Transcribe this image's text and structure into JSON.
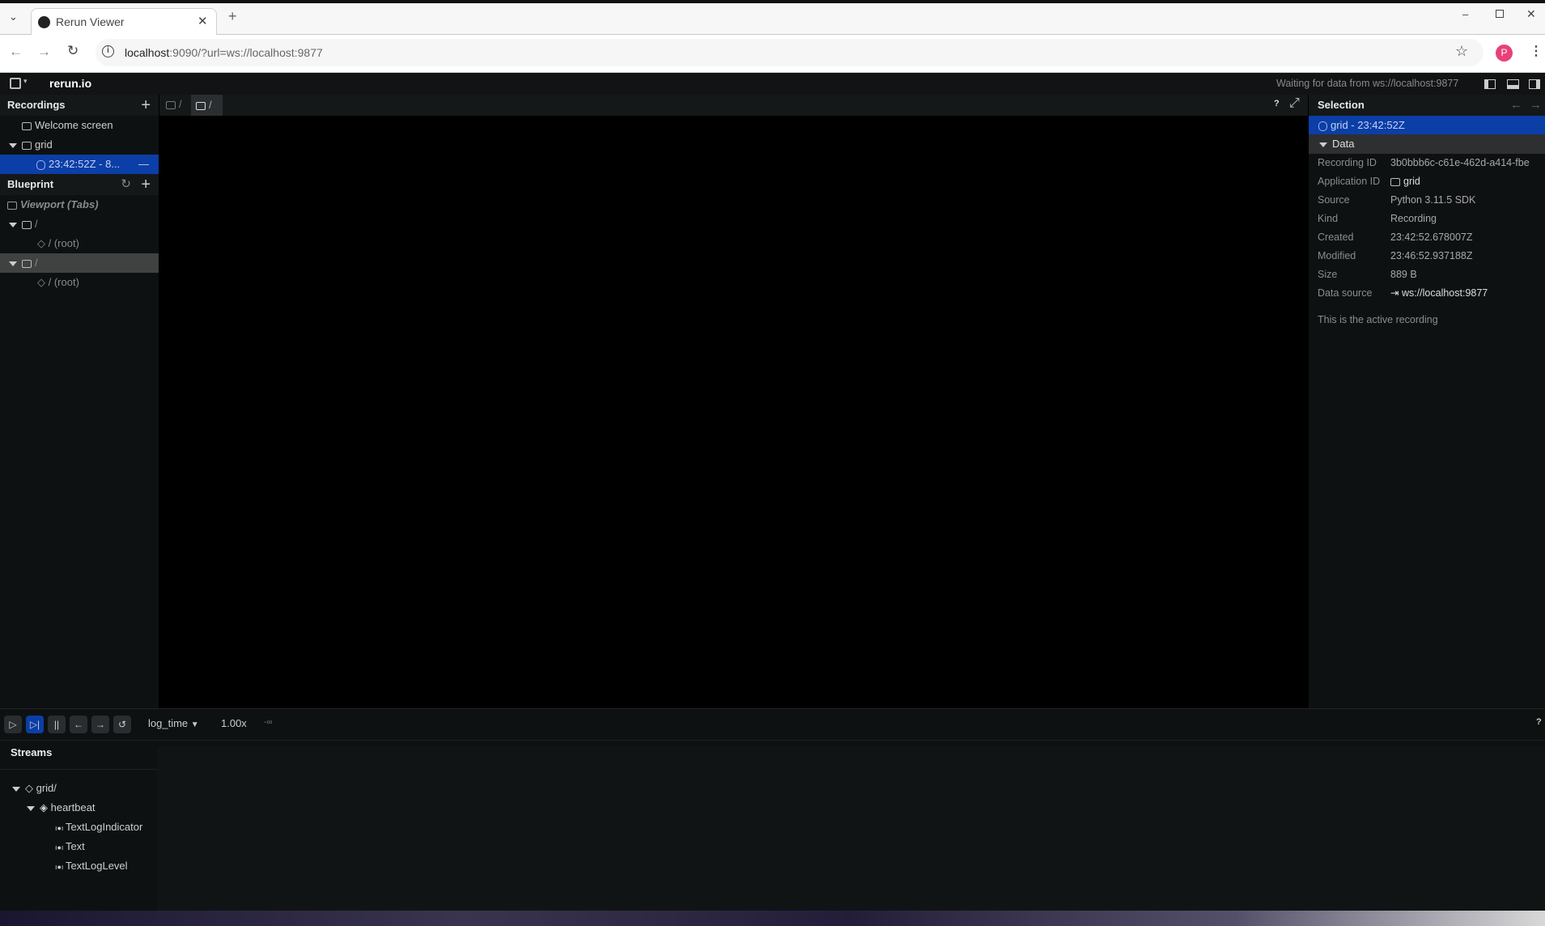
{
  "browser": {
    "tab_title": "Rerun Viewer",
    "url_host": "localhost",
    "url_rest": ":9090/?url=ws://localhost:9877",
    "profile_initial": "P"
  },
  "topbar": {
    "brand": "rerun.io",
    "status": "Waiting for data from ws://localhost:9877"
  },
  "recordings": {
    "title": "Recordings",
    "items": [
      {
        "label": "Welcome screen"
      },
      {
        "label": "grid"
      },
      {
        "label": "23:42:52Z - 8..."
      }
    ]
  },
  "blueprint": {
    "title": "Blueprint",
    "viewport": "Viewport (Tabs)",
    "items": [
      {
        "label": "/"
      },
      {
        "label": "/ (root)"
      },
      {
        "label": "/"
      },
      {
        "label": "/ (root)"
      }
    ]
  },
  "view_tabs": [
    {
      "label": "/"
    },
    {
      "label": "/"
    }
  ],
  "view_help": "?",
  "selection": {
    "title": "Selection",
    "selected": "grid - 23:42:52Z",
    "section": "Data",
    "fields": [
      {
        "k": "Recording ID",
        "v": "3b0bbb6c-c61e-462d-a414-fbe"
      },
      {
        "k": "Application ID",
        "v": "grid"
      },
      {
        "k": "Source",
        "v": "Python 3.11.5 SDK"
      },
      {
        "k": "Kind",
        "v": "Recording"
      },
      {
        "k": "Created",
        "v": "23:42:52.678007Z"
      },
      {
        "k": "Modified",
        "v": "23:46:52.937188Z"
      },
      {
        "k": "Size",
        "v": "889 B"
      },
      {
        "k": "Data source",
        "v": "ws://localhost:9877"
      }
    ],
    "note": "This is the active recording"
  },
  "timeline": {
    "timeline_name": "log_time",
    "speed": "1.00x",
    "time": "-∞",
    "help": "?",
    "streams_title": "Streams",
    "tree": [
      {
        "label": "grid/"
      },
      {
        "label": "heartbeat"
      },
      {
        "label": "TextLogIndicator"
      },
      {
        "label": "Text"
      },
      {
        "label": "TextLogLevel"
      }
    ]
  },
  "colors": {
    "accent": "#0b3ea6",
    "bg": "#0e1112"
  }
}
